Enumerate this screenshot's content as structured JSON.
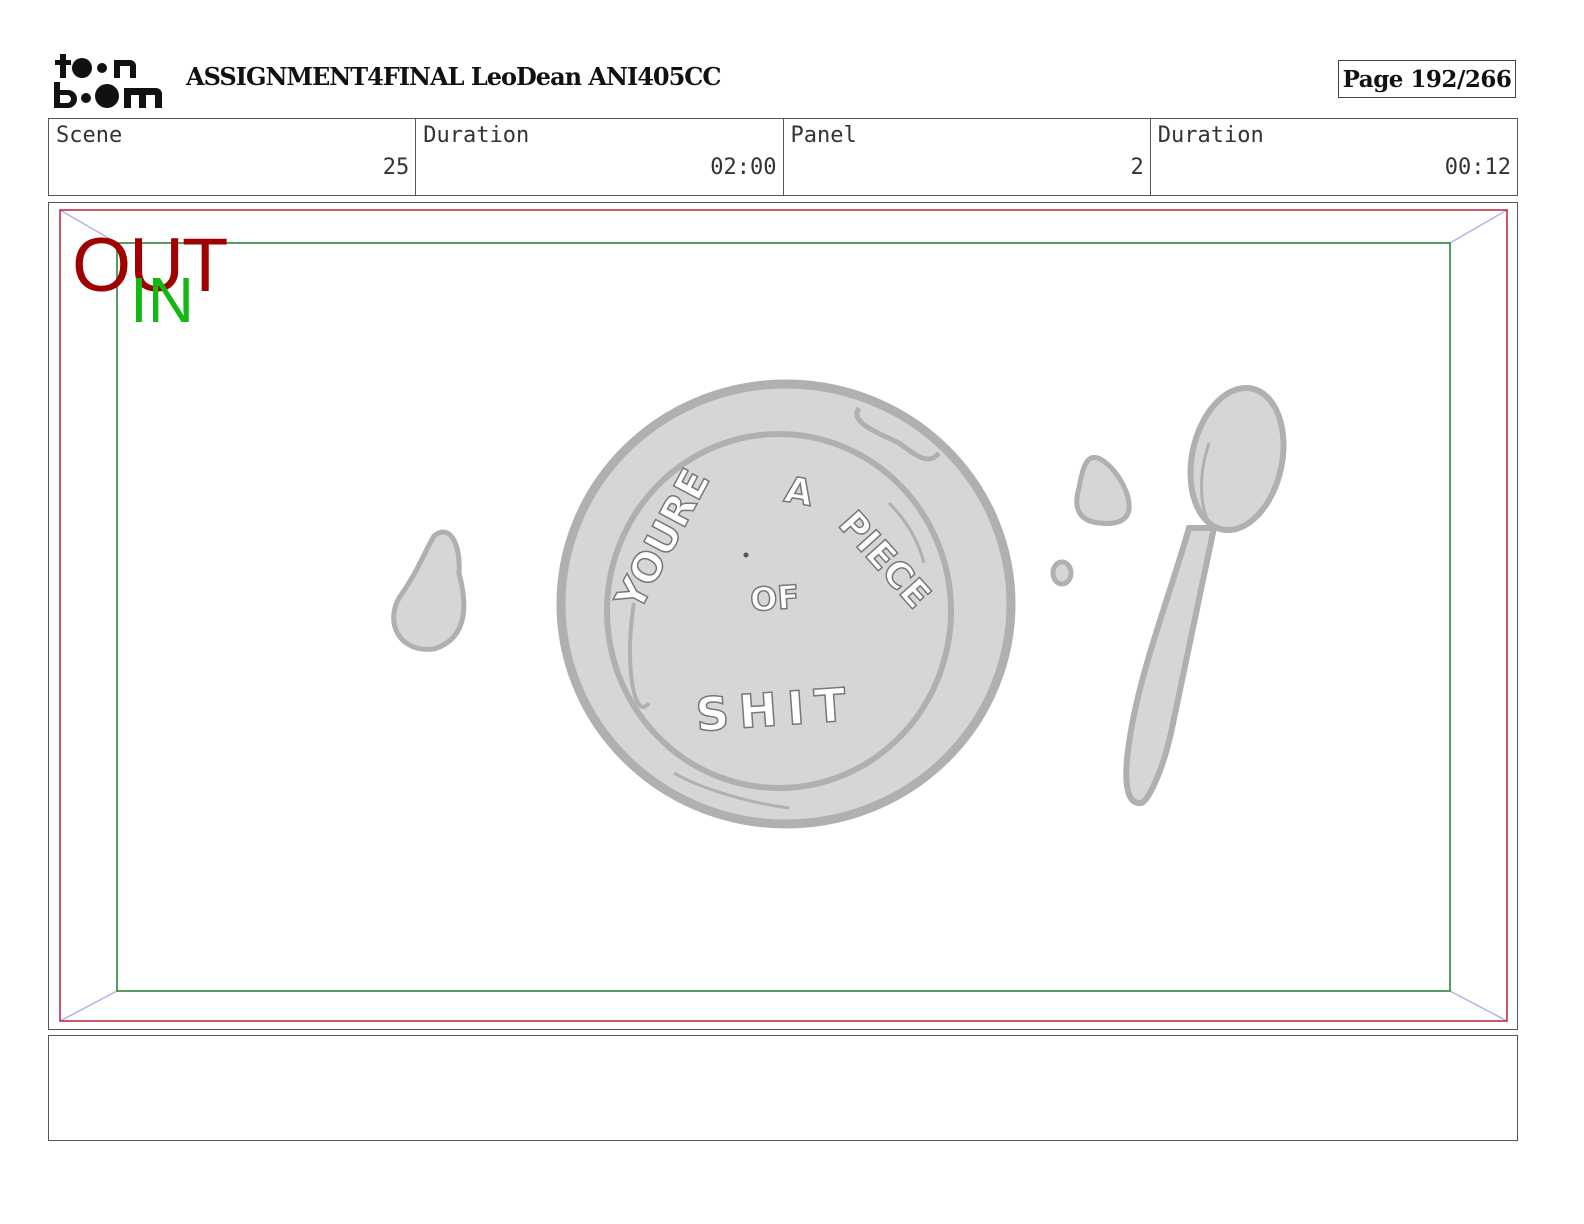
{
  "header": {
    "logo_text": "toon boom",
    "title": "ASSIGNMENT4FINAL LeoDean ANI405CC",
    "page": "Page 192/266"
  },
  "info": [
    {
      "label": "Scene",
      "value": "25"
    },
    {
      "label": "Duration",
      "value": "02:00"
    },
    {
      "label": "Panel",
      "value": "2"
    },
    {
      "label": "Duration",
      "value": "00:12"
    }
  ],
  "panel": {
    "out_label": "OUT",
    "in_label": "IN",
    "drawing": {
      "subject": "bowl-of-alphabet-soup-with-spoon",
      "soup_letters": [
        "YOURE",
        "A",
        "PIECE",
        "OF",
        "SHIT"
      ]
    },
    "colors": {
      "out_frame": "#c0203a",
      "in_frame": "#1f7a2a",
      "guide_lines": "#b8b0e8",
      "sketch_fill": "#d6d6d6",
      "sketch_stroke": "#b0b0b0"
    }
  },
  "notes": {
    "text": ""
  }
}
